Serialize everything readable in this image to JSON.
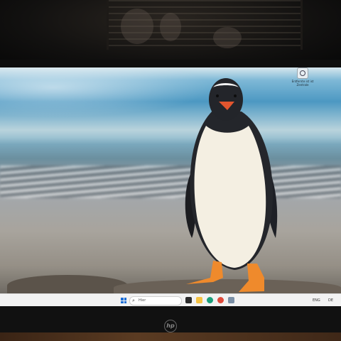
{
  "desktop": {
    "icon": {
      "name": "recycle-bin-icon",
      "label": "Entfernte ist ist Zentrale"
    }
  },
  "taskbar": {
    "search_placeholder": "Hier",
    "tray_left": "ENG",
    "tray_right": "DE",
    "apps": [
      {
        "name": "task-view-icon",
        "color": "#2b2b2b"
      },
      {
        "name": "file-explorer-icon",
        "color": "#f5c242"
      },
      {
        "name": "edge-browser-icon",
        "color": "#1a9f7a"
      },
      {
        "name": "chrome-icon",
        "color": "#e04a3a"
      },
      {
        "name": "settings-icon",
        "color": "#7a8fa6"
      }
    ]
  },
  "monitor": {
    "brand": "hp"
  },
  "colors": {
    "accent": "#1c6ed6",
    "taskbar": "#f2f2f2"
  }
}
